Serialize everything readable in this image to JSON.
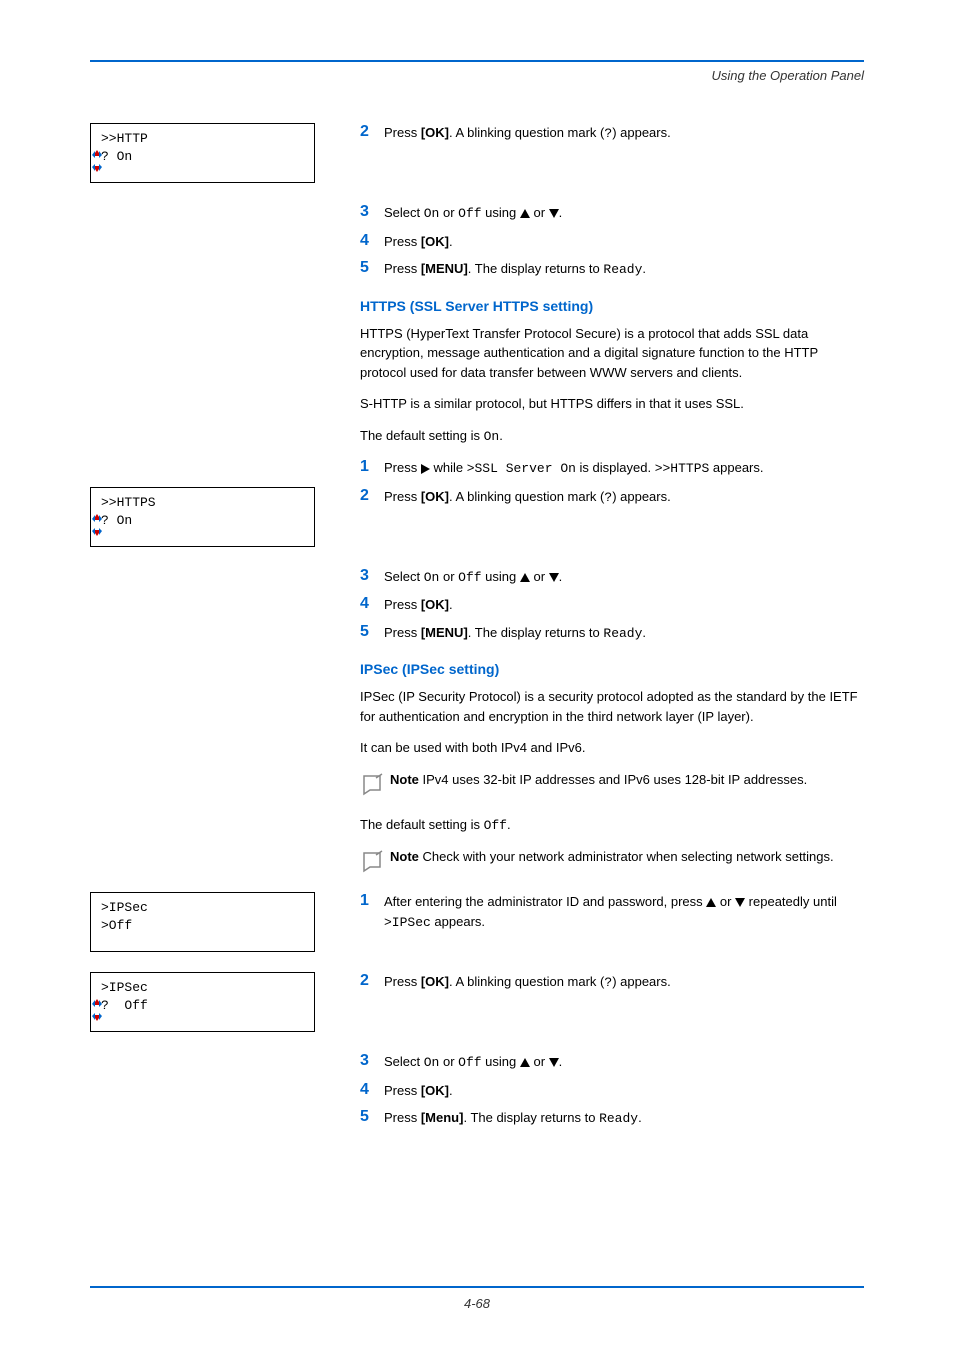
{
  "header": {
    "title": "Using the Operation Panel"
  },
  "footer": {
    "page": "4-68"
  },
  "lcd1": {
    "line1": ">>HTTP",
    "line2": "? On"
  },
  "lcd2": {
    "line1": ">>HTTPS",
    "line2": "? On"
  },
  "lcd3": {
    "line1": ">IPSec",
    "line2": ">Off"
  },
  "lcd4": {
    "line1": ">IPSec",
    "line2": "?  Off"
  },
  "steps": {
    "s2a_pre": "Press ",
    "s2a_bold": "[OK]",
    "s2a_post": ". A blinking question mark (",
    "s2a_q": "?",
    "s2a_end": ") appears.",
    "s3a_pre": "Select ",
    "s3a_on": "On",
    "s3a_or": " or ",
    "s3a_off": "Off",
    "s3a_using": " using ",
    "s3a_ortxt": " or ",
    "s3a_dot": ".",
    "s4a_pre": "Press ",
    "s4a_bold": "[OK]",
    "s4a_dot": ".",
    "s5a_pre": "Press ",
    "s5a_bold": "[MENU]",
    "s5a_post": ". The display returns to ",
    "s5a_ready": "Ready",
    "s5a_dot": ".",
    "s1b_pre": "Press ",
    "s1b_post": " while ",
    "s1b_sslsrv": ">SSL Server On",
    "s1b_disp": " is displayed. ",
    "s1b_https": ">>HTTPS",
    "s1b_app": " appears.",
    "s5c_pre": "Press ",
    "s5c_bold": "[Menu]",
    "s5c_post": ". The display returns to ",
    "s5c_ready": "Ready",
    "s5c_dot": ".",
    "s1c_pre": "After entering the administrator ID and password, press ",
    "s1c_or": " or ",
    "s1c_post": " repeatedly until ",
    "s1c_ipsec": ">IPSec",
    "s1c_app": " appears."
  },
  "headings": {
    "https": "HTTPS (SSL Server HTTPS setting)",
    "ipsec": "IPSec (IPSec setting)"
  },
  "paras": {
    "https1": "HTTPS (HyperText Transfer Protocol Secure) is a protocol that adds SSL data encryption, message authentication and a digital signature function to the HTTP protocol used for data transfer between WWW servers and clients.",
    "https2": "S-HTTP is a similar protocol, but HTTPS differs in that it uses SSL.",
    "https3_pre": "The default setting is ",
    "https3_val": "On",
    "https3_dot": ".",
    "ipsec1": "IPSec (IP Security Protocol) is a security protocol adopted as the standard by the IETF for authentication and encryption in the third network layer (IP layer).",
    "ipsec2": "It can be used with both IPv4 and IPv6.",
    "ipsec3_pre": "The default setting is ",
    "ipsec3_val": "Off",
    "ipsec3_dot": "."
  },
  "notes": {
    "n1_bold": "Note",
    "n1_text": "  IPv4 uses 32-bit IP addresses and IPv6 uses 128-bit IP addresses.",
    "n2_bold": "Note",
    "n2_text": "  Check with your network administrator when selecting network settings."
  },
  "nums": {
    "n1": "1",
    "n2": "2",
    "n3": "3",
    "n4": "4",
    "n5": "5"
  }
}
